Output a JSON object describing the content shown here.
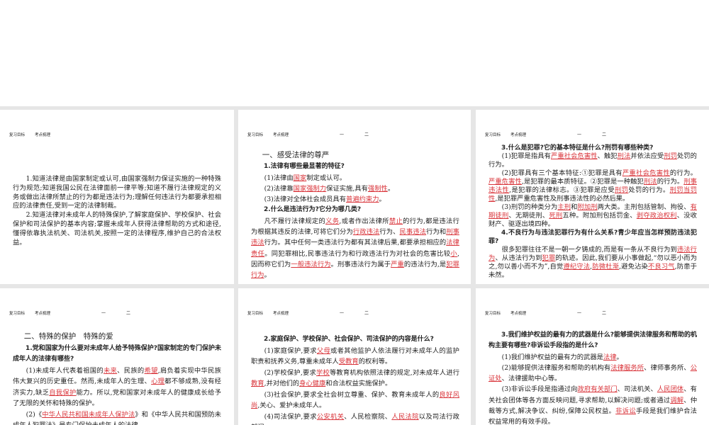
{
  "header": {
    "tab1": "复习目标",
    "tab2": "考点梳理",
    "nav1": "一",
    "nav2": "二"
  },
  "slides": [
    {
      "paragraphs": [
        {
          "type": "p",
          "segs": [
            {
              "t": "1.知道法律是由国家制定或认可,由国家强制力保证实施的一种特殊行为规范;知道我国公民在法律面前一律平等;知道不履行法律规定的义务或做出法律所禁止的行为都是违法行为;理解任何违法行为都要承担相应的法律责任,受到一定的法律制裁。"
            }
          ]
        },
        {
          "type": "p",
          "segs": [
            {
              "t": "2.知道法律对未成年人的特殊保护,了解家庭保护、学校保护、社会保护和司法保护的基本内容;掌握未成年人获得法律帮助的方式和途径,懂得依靠执法机关、司法机关,按照一定的法律程序,维护自己的合法权益。"
            }
          ]
        }
      ]
    },
    {
      "paragraphs": [
        {
          "type": "h1",
          "segs": [
            {
              "t": "一、感受法律的尊严"
            }
          ]
        },
        {
          "type": "h2",
          "segs": [
            {
              "t": "1.法律有哪些最显著的特征?"
            }
          ]
        },
        {
          "type": "p",
          "segs": [
            {
              "t": "(1)法律由"
            },
            {
              "t": "国家",
              "k": "red"
            },
            {
              "t": "制定或认可。"
            }
          ]
        },
        {
          "type": "p",
          "segs": [
            {
              "t": "(2)法律靠"
            },
            {
              "t": "国家强制力",
              "k": "red"
            },
            {
              "t": "保证实施,具有"
            },
            {
              "t": "强制性",
              "k": "red"
            },
            {
              "t": "。"
            }
          ]
        },
        {
          "type": "p",
          "segs": [
            {
              "t": "(3)法律对全体社会成员具有"
            },
            {
              "t": "普遍约束力",
              "k": "red"
            },
            {
              "t": "。"
            }
          ]
        },
        {
          "type": "h2",
          "segs": [
            {
              "t": "2.什么是违法行为?它分为哪几类?"
            }
          ]
        },
        {
          "type": "p",
          "segs": [
            {
              "t": "凡不履行法律规定的"
            },
            {
              "t": "义务",
              "k": "red"
            },
            {
              "t": ",或者作出法律所"
            },
            {
              "t": "禁止",
              "k": "red"
            },
            {
              "t": "的行为,都是违法行为根据其违反的法律,可将它们分为"
            },
            {
              "t": "行政违法",
              "k": "red"
            },
            {
              "t": "行为、"
            },
            {
              "t": "民事违法",
              "k": "red"
            },
            {
              "t": "行为和"
            },
            {
              "t": "刑事违法",
              "k": "red"
            },
            {
              "t": "行为。其中任何一类违法行为都有其法律后果,都要承担相应的"
            },
            {
              "t": "法律责任",
              "k": "red"
            },
            {
              "t": "。同犯罪相比,民事违法行为和行政违法行为对社会的危害比较"
            },
            {
              "t": "小",
              "k": "red"
            },
            {
              "t": ",因而称它们为"
            },
            {
              "t": "一般违法行为",
              "k": "red"
            },
            {
              "t": "。刑事违法行为属于"
            },
            {
              "t": "严重",
              "k": "red"
            },
            {
              "t": "的违法行为,是"
            },
            {
              "t": "犯罪行为",
              "k": "red"
            },
            {
              "t": "。"
            }
          ]
        }
      ]
    },
    {
      "paragraphs": [
        {
          "type": "h2",
          "segs": [
            {
              "t": "3.什么是犯罪?它的基本特征是什么?刑罚有哪些种类?"
            }
          ]
        },
        {
          "type": "p",
          "segs": [
            {
              "t": "(1)犯罪是指具有"
            },
            {
              "t": "严重社会危害性",
              "k": "red"
            },
            {
              "t": "、触犯"
            },
            {
              "t": "刑法",
              "k": "red"
            },
            {
              "t": "并依法应受"
            },
            {
              "t": "刑罚",
              "k": "red"
            },
            {
              "t": "处罚的行为。"
            }
          ]
        },
        {
          "type": "p",
          "segs": [
            {
              "t": "(2)犯罪具有三个基本特征:①犯罪是具有"
            },
            {
              "t": "严重社会危害性",
              "k": "red"
            },
            {
              "t": "的行为。"
            },
            {
              "t": "严重危害性",
              "k": "red"
            },
            {
              "t": ",是犯罪的最本质特征。②犯罪是一种触犯"
            },
            {
              "t": "刑法",
              "k": "red"
            },
            {
              "t": "的行为。"
            },
            {
              "t": "刑事违法性",
              "k": "red"
            },
            {
              "t": ",是犯罪的法律标志。③犯罪是应受"
            },
            {
              "t": "刑罚",
              "k": "red"
            },
            {
              "t": "处罚的行为。"
            },
            {
              "t": "刑罚当罚性",
              "k": "red"
            },
            {
              "t": ",是犯罪严重危害性及刑事违法性的必然后果。"
            }
          ]
        },
        {
          "type": "p",
          "segs": [
            {
              "t": "(3)刑罚的种类分为"
            },
            {
              "t": "主刑",
              "k": "red"
            },
            {
              "t": "和"
            },
            {
              "t": "附加刑",
              "k": "red"
            },
            {
              "t": "两大类。主刑包括管制、拘役、"
            },
            {
              "t": "有期徒刑",
              "k": "red"
            },
            {
              "t": "、无期徒刑、"
            },
            {
              "t": "死刑",
              "k": "red"
            },
            {
              "t": "五种。附加刑包括罚金、"
            },
            {
              "t": "剥夺政治权利",
              "k": "red"
            },
            {
              "t": "、没收财产、驱逐出境四种。"
            }
          ]
        },
        {
          "type": "h2",
          "segs": [
            {
              "t": "4.不良行为与违法犯罪行为有什么关系?青少年应当怎样预防违法犯罪?"
            }
          ]
        },
        {
          "type": "p",
          "segs": [
            {
              "t": "很多犯罪往往不是一朝一夕铸成的,而是有一条从不良行为到"
            },
            {
              "t": "违法行为",
              "k": "red"
            },
            {
              "t": "、从违法行为到"
            },
            {
              "t": "犯罪",
              "k": "red"
            },
            {
              "t": "的轨迹。因此,我们要从小事做起,“勿以恶小而为之,勿以善小而不为”,自觉"
            },
            {
              "t": "遵纪守法",
              "k": "red"
            },
            {
              "t": ","
            },
            {
              "t": "防微杜渐",
              "k": "red"
            },
            {
              "t": ",避免沾染"
            },
            {
              "t": "不良习气",
              "k": "red"
            },
            {
              "t": ",防患于未然。"
            }
          ]
        }
      ]
    },
    {
      "paragraphs": [
        {
          "type": "h1",
          "segs": [
            {
              "t": "二、特殊的保护　特殊的爱"
            }
          ]
        },
        {
          "type": "h2",
          "segs": [
            {
              "t": "1.党和国家为什么要对未成年人给予特殊保护?国家制定的专门保护未成年人的法律有哪些?"
            }
          ]
        },
        {
          "type": "p",
          "segs": [
            {
              "t": "(1)未成年人代表着祖国的"
            },
            {
              "t": "未来",
              "k": "red"
            },
            {
              "t": "、民族的"
            },
            {
              "t": "希望",
              "k": "red"
            },
            {
              "t": ",肩负着实现中华民族伟大复兴的历史重任。然而,未成年人的生理、"
            },
            {
              "t": "心理",
              "k": "red"
            },
            {
              "t": "都不够成熟,没有经济实力,缺乏"
            },
            {
              "t": "自我保护",
              "k": "red"
            },
            {
              "t": "能力。所以,党和国家对未成年人的健康成长给予了无限的关怀和特殊的保护。"
            }
          ]
        },
        {
          "type": "p",
          "segs": [
            {
              "t": "(2)《"
            },
            {
              "t": "中华人民共和国未成年人保护法",
              "k": "red"
            },
            {
              "t": "》和《中华人民共和国预防未成年人犯罪法》是专门保护未成年人的法律。"
            }
          ]
        }
      ]
    },
    {
      "paragraphs": [
        {
          "type": "h2",
          "segs": [
            {
              "t": "2.家庭保护、学校保护、社会保护、司法保护的内容是什么?"
            }
          ]
        },
        {
          "type": "p",
          "segs": [
            {
              "t": "(1)家庭保护,要求"
            },
            {
              "t": "父母",
              "k": "red"
            },
            {
              "t": "或者其他监护人依法履行对未成年人的监护职责和抚养义务,尊重未成年人"
            },
            {
              "t": "受教育",
              "k": "red"
            },
            {
              "t": "的权利等。"
            }
          ]
        },
        {
          "type": "p",
          "segs": [
            {
              "t": "(2)学校保护,要求"
            },
            {
              "t": "学校",
              "k": "red"
            },
            {
              "t": "等教育机构依照法律的规定,对未成年人进行"
            },
            {
              "t": "教育",
              "k": "red"
            },
            {
              "t": ",并对他们的"
            },
            {
              "t": "身心健康",
              "k": "red"
            },
            {
              "t": "和合法权益实施保护。"
            }
          ]
        },
        {
          "type": "p",
          "segs": [
            {
              "t": "(3)社会保护,要求全社会树立尊重、保护、教育未成年人的"
            },
            {
              "t": "良好风尚",
              "k": "red"
            },
            {
              "t": ",关心、爱护未成年人。"
            }
          ]
        },
        {
          "type": "p",
          "segs": [
            {
              "t": "(4)司法保护,要求"
            },
            {
              "t": "公安机关",
              "k": "red"
            },
            {
              "t": "、人民检察院、"
            },
            {
              "t": "人民法院",
              "k": "red"
            },
            {
              "t": "以及司法行政部门"
            }
          ]
        }
      ]
    },
    {
      "paragraphs": [
        {
          "type": "h2",
          "segs": [
            {
              "t": "3.我们维护权益的最有力的武器是什么?能够提供法律服务和帮助的机构主要有哪些?非诉讼手段指的是什么?"
            }
          ]
        },
        {
          "type": "p",
          "segs": [
            {
              "t": "(1)我们维护权益的最有力的武器是"
            },
            {
              "t": "法律",
              "k": "red"
            },
            {
              "t": "。"
            }
          ]
        },
        {
          "type": "p",
          "segs": [
            {
              "t": "(2)能够提供法律服务和帮助的机构有"
            },
            {
              "t": "法律服务所",
              "k": "red"
            },
            {
              "t": "、律师事务所、"
            },
            {
              "t": "公证处",
              "k": "red"
            },
            {
              "t": "、法律援助中心等。"
            }
          ]
        },
        {
          "type": "p",
          "segs": [
            {
              "t": "(3)非诉讼手段是指通过向"
            },
            {
              "t": "政府有关部门",
              "k": "red"
            },
            {
              "t": "、司法机关、"
            },
            {
              "t": "人民团体",
              "k": "red"
            },
            {
              "t": "、有关社会团体等各方面反映问题,寻求帮助,以解决问题;或者通过"
            },
            {
              "t": "调解",
              "k": "red"
            },
            {
              "t": "、仲裁等方式,解决争议、纠纷,保障公民权益。"
            },
            {
              "t": "非诉讼",
              "k": "red"
            },
            {
              "t": "手段是我们维护合法权益常用的有效手段。"
            }
          ]
        }
      ]
    }
  ]
}
